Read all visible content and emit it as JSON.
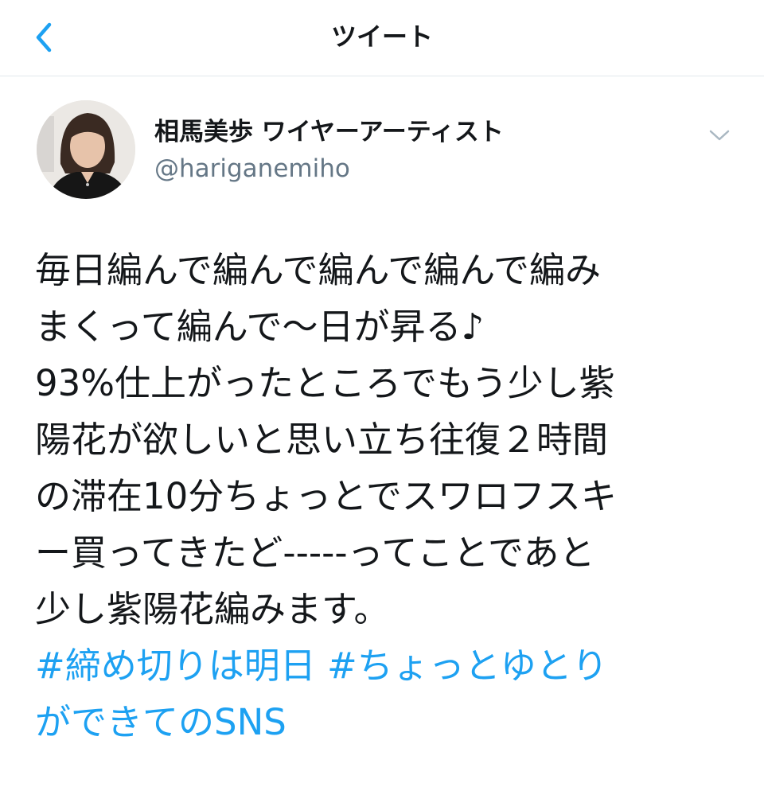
{
  "nav": {
    "title": "ツイート",
    "back_icon": "chevron-left-icon"
  },
  "author": {
    "name": "相馬美歩 ワイヤーアーティスト",
    "handle": "@hariganemiho",
    "avatar": "avatar-photo"
  },
  "tweet": {
    "lines": [
      "毎日編んで編んで編んで編んで編み",
      "まくって編んで〜日が昇る♪",
      "93%仕上がったところでもう少し紫",
      "陽花が欲しいと思い立ち往復２時間",
      "の滞在10分ちょっとでスワロフスキ",
      "ー買ってきたど-----ってことであと",
      "少し紫陽花編みます。"
    ],
    "hashtags": {
      "tag1": "#締め切りは明日",
      "tag2": "#ちょっとゆとり",
      "tag2_cont": "ができてのSNS"
    }
  },
  "colors": {
    "accent": "#1da1f2",
    "text": "#14171a",
    "secondary": "#657786",
    "divider": "#e1e8ed"
  }
}
